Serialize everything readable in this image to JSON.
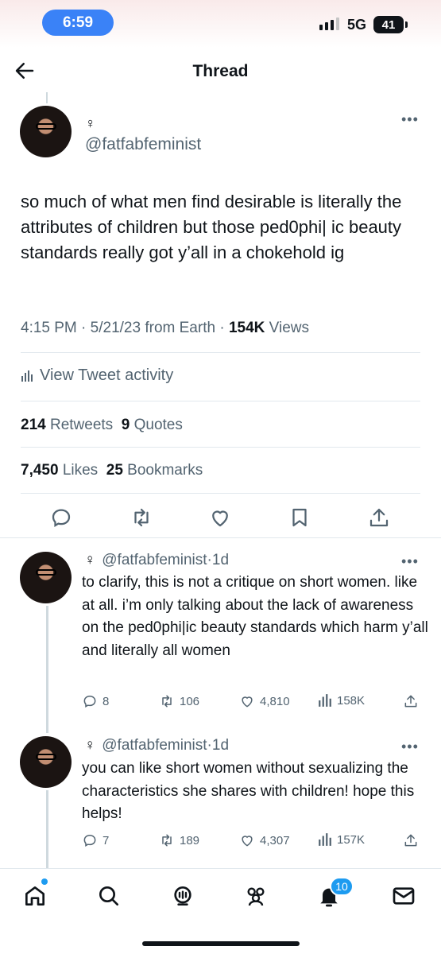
{
  "status_bar": {
    "time": "6:59",
    "network": "5G",
    "battery": "41"
  },
  "header": {
    "title": "Thread"
  },
  "tweet": {
    "gender_symbol": "♀",
    "handle": "@fatfabfeminist",
    "text": "so much of what men find desirable is literally the attributes of children but those ped0phi| ic beauty standards really got y’all in a chokehold ig",
    "time": "4:15 PM",
    "date": "5/21/23",
    "source": "from Earth",
    "views_count": "154K",
    "views_label": "Views",
    "activity_label": "View Tweet activity",
    "retweets_count": "214",
    "retweets_label": "Retweets",
    "quotes_count": "9",
    "quotes_label": "Quotes",
    "likes_count": "7,450",
    "likes_label": "Likes",
    "bookmarks_count": "25",
    "bookmarks_label": "Bookmarks"
  },
  "replies": [
    {
      "gender_symbol": "♀",
      "handle": "@fatfabfeminist",
      "age": "1d",
      "text": "to clarify, this is not a critique on short women. like at all. i’m only talking about the lack of awareness on the ped0phi|ic beauty standards which harm y’all and literally all women",
      "comments": "8",
      "retweets": "106",
      "likes": "4,810",
      "views": "158K"
    },
    {
      "gender_symbol": "♀",
      "handle": "@fatfabfeminist",
      "age": "1d",
      "text": "you can like short women without sexualizing the characteristics she shares with children! hope this helps!",
      "comments": "7",
      "retweets": "189",
      "likes": "4,307",
      "views": "157K"
    }
  ],
  "bottom_nav": {
    "notifications_badge": "10"
  },
  "colors": {
    "accent": "#1d9bf0",
    "text": "#0f1419",
    "secondary": "#536471",
    "time_pill": "#3a82f7"
  }
}
